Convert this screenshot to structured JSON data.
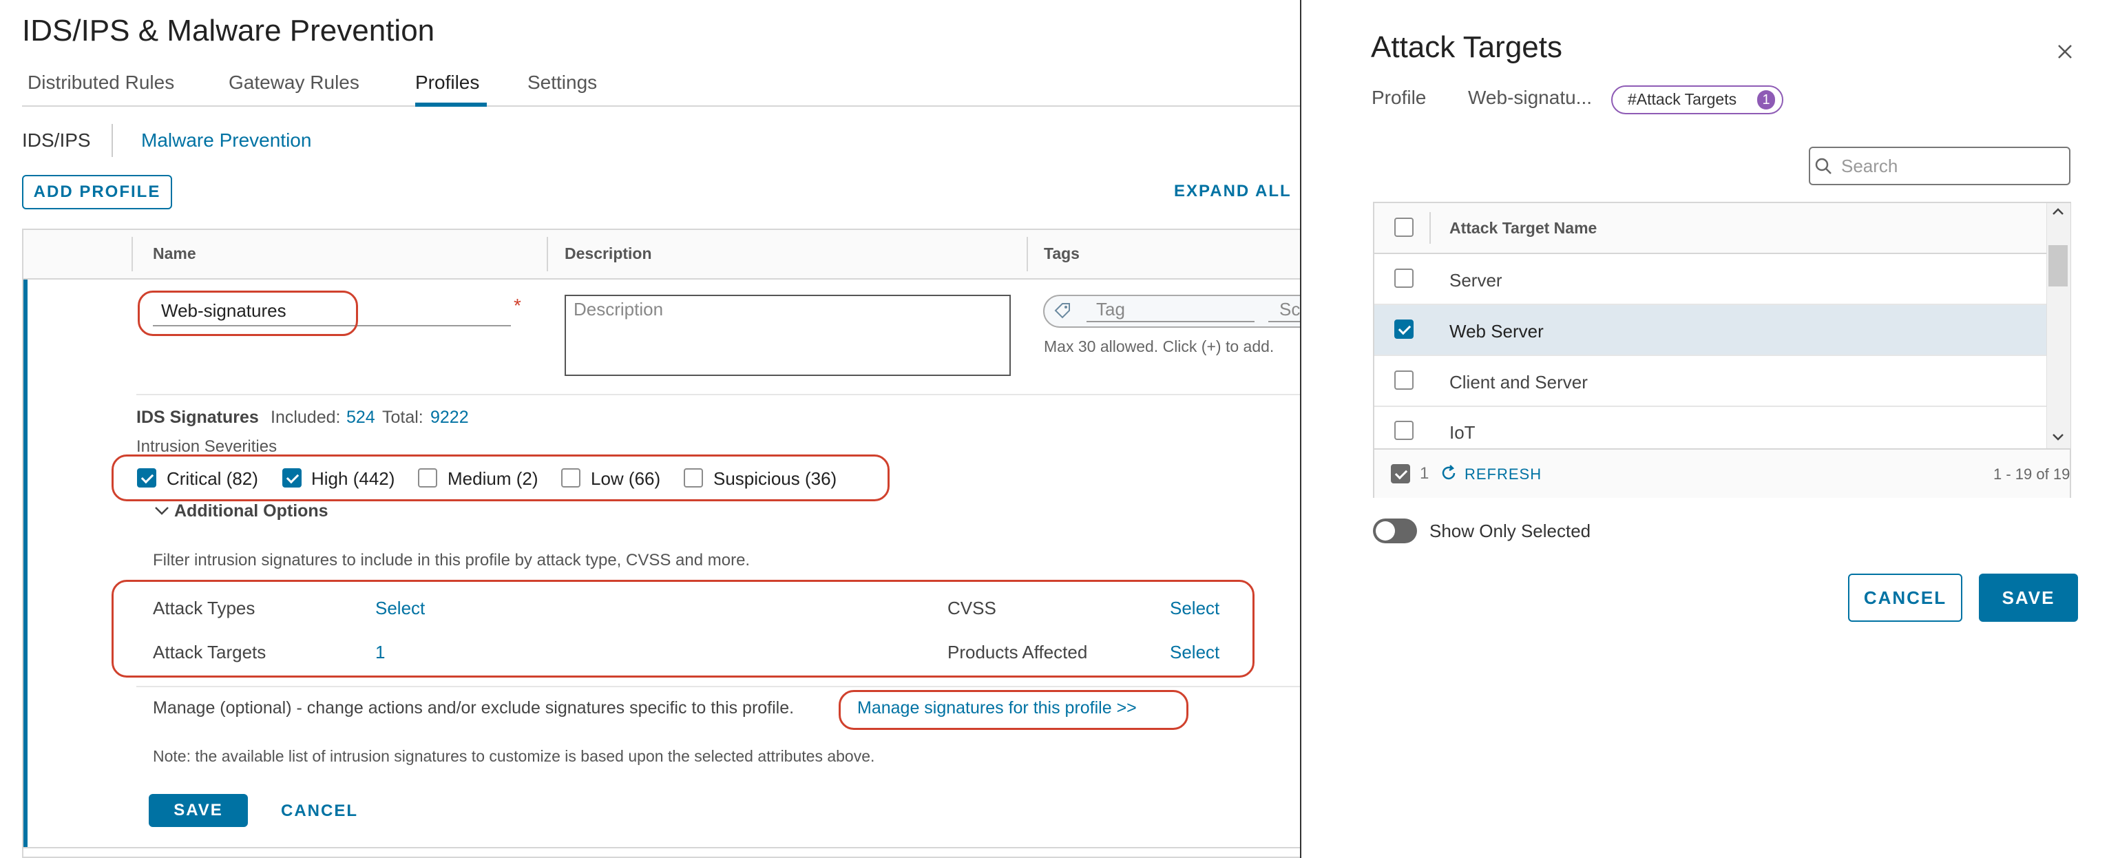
{
  "page": {
    "title": "IDS/IPS & Malware Prevention",
    "tabs": [
      "Distributed Rules",
      "Gateway Rules",
      "Profiles",
      "Settings"
    ],
    "subtabs": [
      "IDS/IPS",
      "Malware Prevention"
    ],
    "add_profile": "ADD PROFILE",
    "expand_all": "EXPAND ALL",
    "columns": [
      "Name",
      "Description",
      "Tags"
    ],
    "name_value": "Web-signatures",
    "required_mark": "*",
    "description_placeholder": "Description",
    "tag_placeholder": "Tag",
    "scope_placeholder": "Sc",
    "tags_help": "Max 30 allowed. Click (+) to add.",
    "ids_signatures": {
      "label": "IDS Signatures",
      "included_label": "Included:",
      "included_value": "524",
      "total_label": "Total:",
      "total_value": "9222"
    },
    "intrusion_severities_label": "Intrusion Severities",
    "severities": [
      {
        "label": "Critical (82)",
        "checked": true
      },
      {
        "label": "High (442)",
        "checked": true
      },
      {
        "label": "Medium (2)",
        "checked": false
      },
      {
        "label": "Low (66)",
        "checked": false
      },
      {
        "label": "Suspicious (36)",
        "checked": false
      }
    ],
    "additional_options": "Additional Options",
    "filter_text": "Filter intrusion signatures to include in this profile by attack type, CVSS and more.",
    "attack_types_label": "Attack Types",
    "attack_types_value": "Select",
    "cvss_label": "CVSS",
    "cvss_value": "Select",
    "attack_targets_label": "Attack Targets",
    "attack_targets_value": "1",
    "products_affected_label": "Products Affected",
    "products_affected_value": "Select",
    "manage_text": "Manage (optional) - change actions and/or exclude signatures specific to this profile.",
    "manage_link": "Manage signatures for this profile >>",
    "note": "Note: the available list of intrusion signatures to customize is based upon the selected attributes above.",
    "save": "SAVE",
    "cancel": "CANCEL"
  },
  "panel": {
    "title": "Attack Targets",
    "close_icon": "close-icon",
    "breadcrumb_profile": "Profile",
    "breadcrumb_name": "Web-signatu...",
    "chip_label": "#Attack Targets",
    "chip_count": "1",
    "search_placeholder": "Search",
    "column": "Attack Target Name",
    "rows": [
      {
        "label": "Server",
        "checked": false
      },
      {
        "label": "Web Server",
        "checked": true
      },
      {
        "label": "Client and Server",
        "checked": false
      },
      {
        "label": "IoT",
        "checked": false
      }
    ],
    "selected_count": "1",
    "refresh": "REFRESH",
    "pagination": "1 - 19 of 19",
    "show_only_selected": "Show Only Selected",
    "cancel": "CANCEL",
    "save": "SAVE"
  },
  "colors": {
    "accent": "#0072a3",
    "highlight_box": "#d0412d",
    "chip_border": "#8e5bb5",
    "selected_row": "#dfe8ef"
  }
}
